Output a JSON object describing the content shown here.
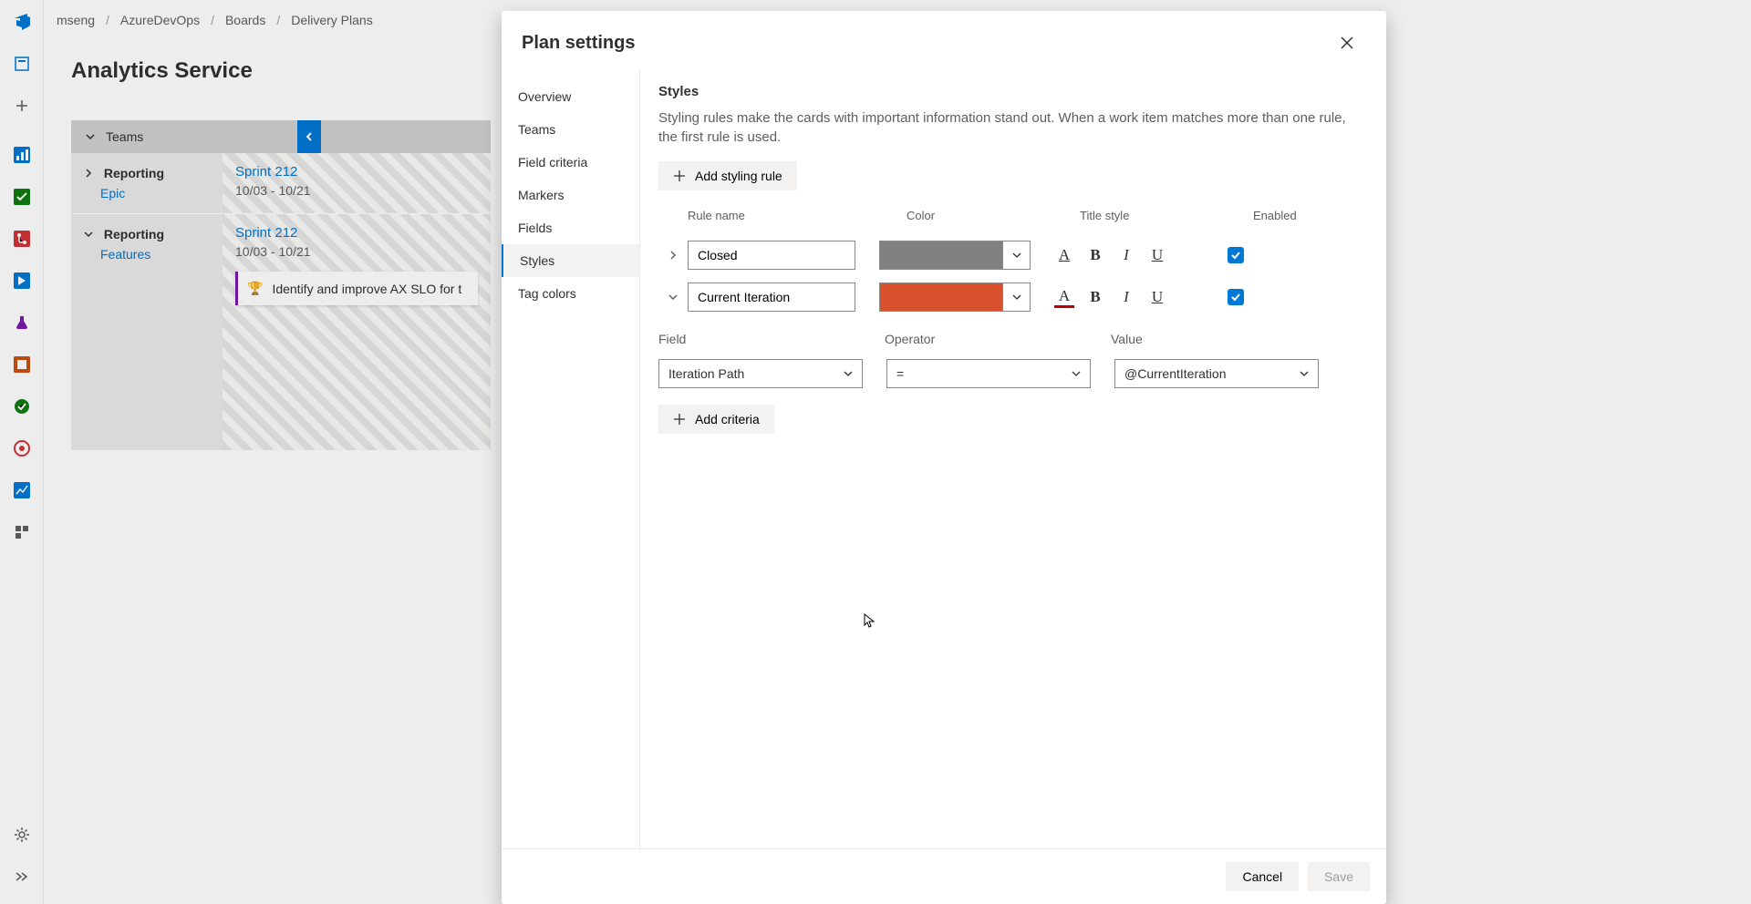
{
  "breadcrumbs": [
    "mseng",
    "AzureDevOps",
    "Boards",
    "Delivery Plans"
  ],
  "page_title": "Analytics Service",
  "teams_header_label": "Teams",
  "teams": [
    {
      "name": "Reporting",
      "type": "Epic",
      "sprint": {
        "title": "Sprint 212",
        "dates": "10/03 - 10/21"
      },
      "cards": []
    },
    {
      "name": "Reporting",
      "type": "Features",
      "sprint": {
        "title": "Sprint 212",
        "dates": "10/03 - 10/21"
      },
      "cards": [
        {
          "text": "Identify and improve AX SLO for t"
        }
      ]
    }
  ],
  "panel": {
    "title": "Plan settings",
    "nav": [
      "Overview",
      "Teams",
      "Field criteria",
      "Markers",
      "Fields",
      "Styles",
      "Tag colors"
    ],
    "selected_nav_index": 5,
    "section_title": "Styles",
    "section_desc": "Styling rules make the cards with important information stand out. When a work item matches more than one rule, the first rule is used.",
    "add_rule_label": "Add styling rule",
    "columns": {
      "rule": "Rule name",
      "color": "Color",
      "tstyle": "Title style",
      "enabled": "Enabled"
    },
    "rules": [
      {
        "expanded": false,
        "name": "Closed",
        "color": "#808080",
        "bold": true,
        "enabled": true
      },
      {
        "expanded": true,
        "name": "Current Iteration",
        "color": "#d6512c",
        "bold": true,
        "underline_color": "#c00000",
        "enabled": true
      }
    ],
    "criteria_headers": {
      "field": "Field",
      "operator": "Operator",
      "value": "Value"
    },
    "criteria": [
      {
        "field": "Iteration Path",
        "operator": "=",
        "value": "@CurrentIteration"
      }
    ],
    "add_criteria_label": "Add criteria",
    "footer": {
      "cancel": "Cancel",
      "save": "Save"
    }
  },
  "sidebar_icons": [
    "azure-devops",
    "project",
    "add",
    "dashboard",
    "board",
    "repo",
    "pipeline",
    "test",
    "artifact",
    "wiki",
    "security",
    "analytics",
    "ext"
  ],
  "sidebar_bottom": [
    "settings",
    "collapse"
  ]
}
